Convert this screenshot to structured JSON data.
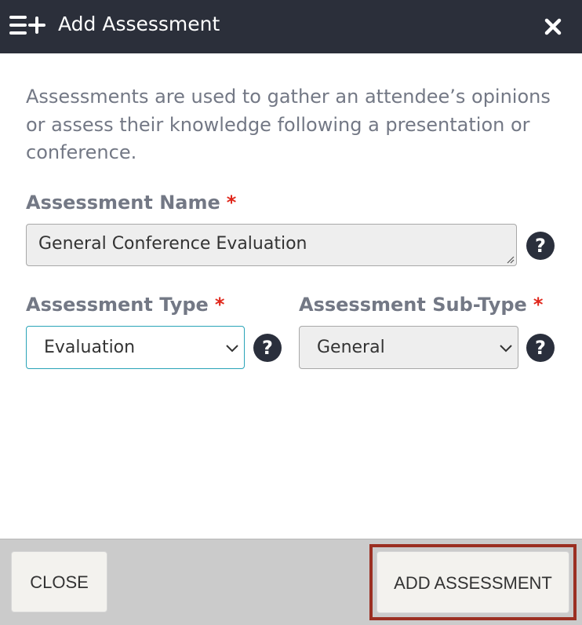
{
  "header": {
    "icon": "add-list-icon",
    "title": "Add Assessment",
    "close_icon": "close-icon"
  },
  "description": "Assessments are used to gather an attendee’s opinions or assess their knowledge following a presentation or conference.",
  "form": {
    "name": {
      "label": "Assessment Name",
      "required_mark": "*",
      "value": "General Conference Evaluation",
      "help_icon": "question-circle-icon",
      "help_glyph": "?"
    },
    "type": {
      "label": "Assessment Type",
      "required_mark": "*",
      "value": "Evaluation",
      "help_icon": "question-circle-icon",
      "help_glyph": "?"
    },
    "subtype": {
      "label": "Assessment Sub-Type",
      "required_mark": "*",
      "value": "General",
      "help_icon": "question-circle-icon",
      "help_glyph": "?"
    }
  },
  "footer": {
    "close_label": "CLOSE",
    "add_label": "ADD ASSESSMENT"
  },
  "colors": {
    "titlebar": "#2b2f3a",
    "required": "#e0261a",
    "focus_border": "#2aa4b8",
    "highlight": "#9b2f22"
  }
}
